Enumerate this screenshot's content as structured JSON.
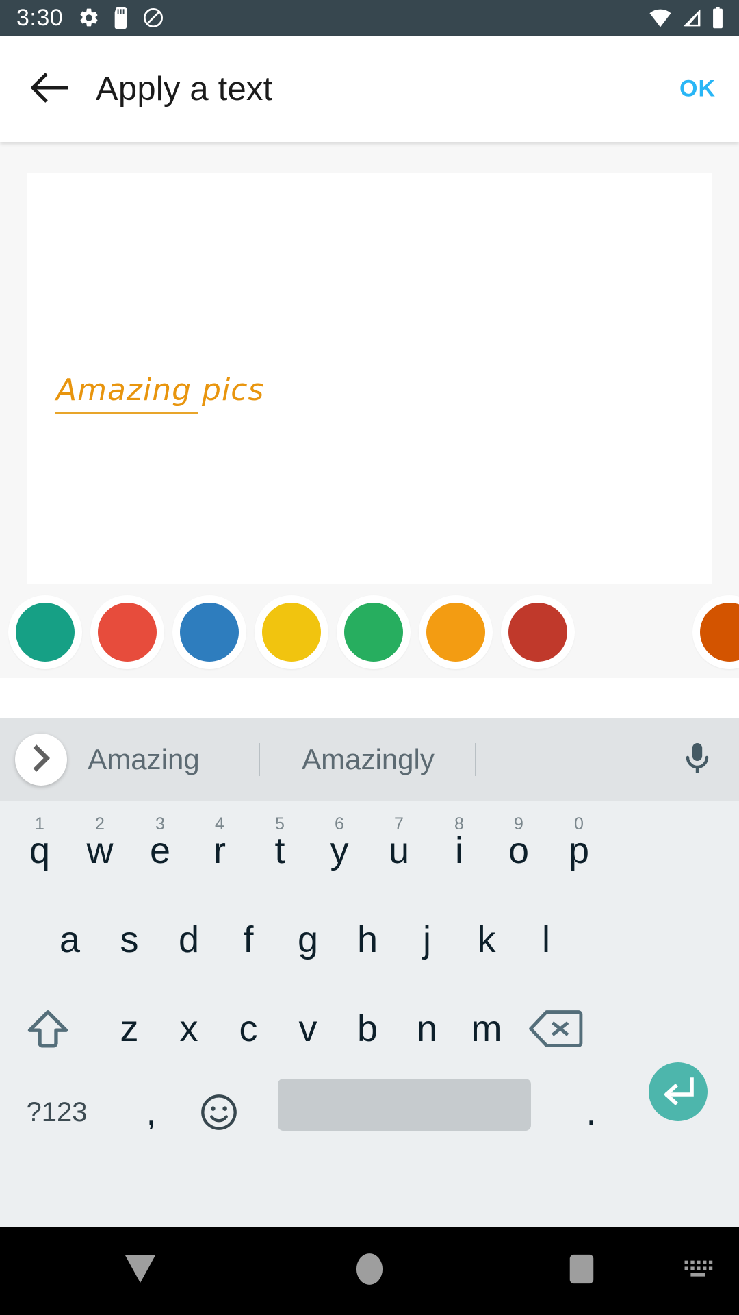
{
  "status_bar": {
    "time": "3:30",
    "left_icons": [
      "settings-gear-icon",
      "sd-card-icon",
      "do-not-disturb-icon"
    ],
    "right_icons": [
      "wifi-icon",
      "cellular-signal-icon",
      "battery-icon"
    ],
    "background": "#37474f"
  },
  "app_bar": {
    "back_icon": "back-arrow-icon",
    "title": "Apply a text",
    "action_label": "OK",
    "action_color": "#29b6f6"
  },
  "editor": {
    "canvas_text": "Amazing pics",
    "text_color": "#e8950e",
    "canvas_background": "#ffffff",
    "area_background": "#f7f7f7"
  },
  "color_swatches": [
    {
      "name": "teal-green",
      "hex": "#16a085"
    },
    {
      "name": "red",
      "hex": "#e74c3c"
    },
    {
      "name": "blue",
      "hex": "#2e7dbe"
    },
    {
      "name": "yellow",
      "hex": "#f1c40f"
    },
    {
      "name": "green",
      "hex": "#27ae5f"
    },
    {
      "name": "orange",
      "hex": "#f39c12"
    },
    {
      "name": "brick-red",
      "hex": "#c0392b"
    },
    {
      "name": "dark-orange",
      "hex": "#d35400"
    }
  ],
  "suggestion_strip": {
    "expand_icon": "chevron-right-icon",
    "suggestions": [
      "Amazing",
      "Amazingly"
    ],
    "mic_icon": "microphone-icon",
    "background": "#e0e3e5"
  },
  "keyboard": {
    "background": "#eceff1",
    "row1": [
      {
        "letter": "q",
        "hint": "1"
      },
      {
        "letter": "w",
        "hint": "2"
      },
      {
        "letter": "e",
        "hint": "3"
      },
      {
        "letter": "r",
        "hint": "4"
      },
      {
        "letter": "t",
        "hint": "5"
      },
      {
        "letter": "y",
        "hint": "6"
      },
      {
        "letter": "u",
        "hint": "7"
      },
      {
        "letter": "i",
        "hint": "8"
      },
      {
        "letter": "o",
        "hint": "9"
      },
      {
        "letter": "p",
        "hint": "0"
      }
    ],
    "row2": [
      {
        "letter": "a"
      },
      {
        "letter": "s"
      },
      {
        "letter": "d"
      },
      {
        "letter": "f"
      },
      {
        "letter": "g"
      },
      {
        "letter": "h"
      },
      {
        "letter": "j"
      },
      {
        "letter": "k"
      },
      {
        "letter": "l"
      }
    ],
    "row3": {
      "shift_icon": "shift-icon",
      "letters": [
        {
          "letter": "z"
        },
        {
          "letter": "x"
        },
        {
          "letter": "c"
        },
        {
          "letter": "v"
        },
        {
          "letter": "b"
        },
        {
          "letter": "n"
        },
        {
          "letter": "m"
        }
      ],
      "backspace_icon": "backspace-icon"
    },
    "row4": {
      "symbols_label": "?123",
      "comma_label": ",",
      "emoji_icon": "emoji-smiley-icon",
      "space_label": "",
      "period_label": ".",
      "enter_icon": "enter-return-icon",
      "enter_color": "#4db6ac",
      "space_color": "#c6cbce"
    }
  },
  "nav_bar": {
    "background": "#000000",
    "items": [
      {
        "name": "hide-keyboard-down-icon"
      },
      {
        "name": "home-circle-icon"
      },
      {
        "name": "recents-square-icon"
      },
      {
        "name": "keyboard-switcher-icon"
      }
    ]
  }
}
